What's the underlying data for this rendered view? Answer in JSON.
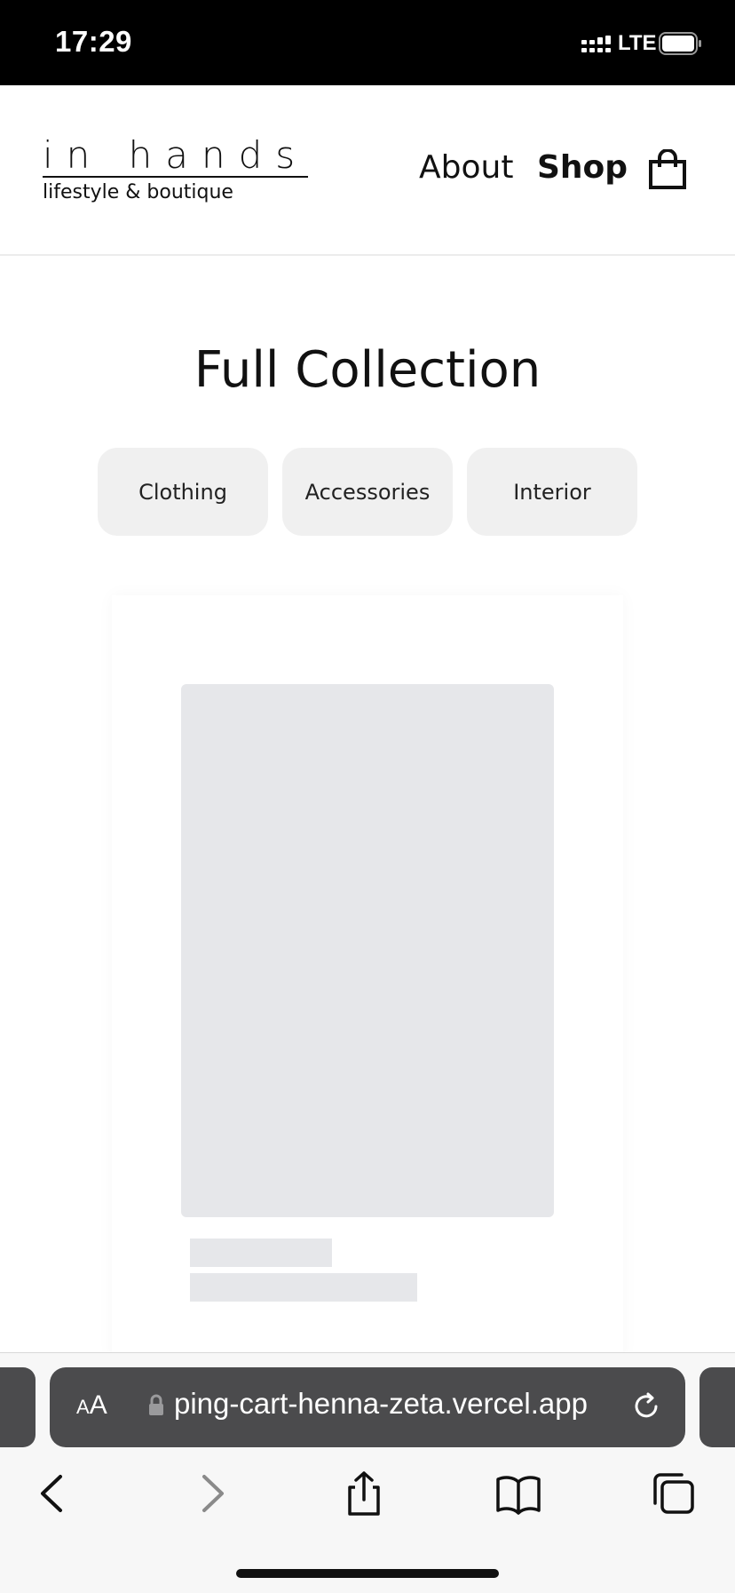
{
  "status_bar": {
    "time": "17:29",
    "network": "LTE"
  },
  "header": {
    "brand_name": "in hands",
    "brand_tagline": "lifestyle & boutique",
    "nav": {
      "about_label": "About",
      "shop_label": "Shop"
    },
    "cart_icon": "shopping-bag-icon"
  },
  "main": {
    "title": "Full Collection",
    "filters": [
      {
        "label": "Clothing"
      },
      {
        "label": "Accessories"
      },
      {
        "label": "Interior"
      }
    ]
  },
  "browser": {
    "text_size_label_small": "A",
    "text_size_label_large": "A",
    "url": "ping-cart-henna-zeta.vercel.app"
  },
  "colors": {
    "status_bar_bg": "#000000",
    "chip_bg": "#f0f0f0",
    "skeleton": "#e6e7ea",
    "address_bar_bg": "#4b4b4d"
  }
}
